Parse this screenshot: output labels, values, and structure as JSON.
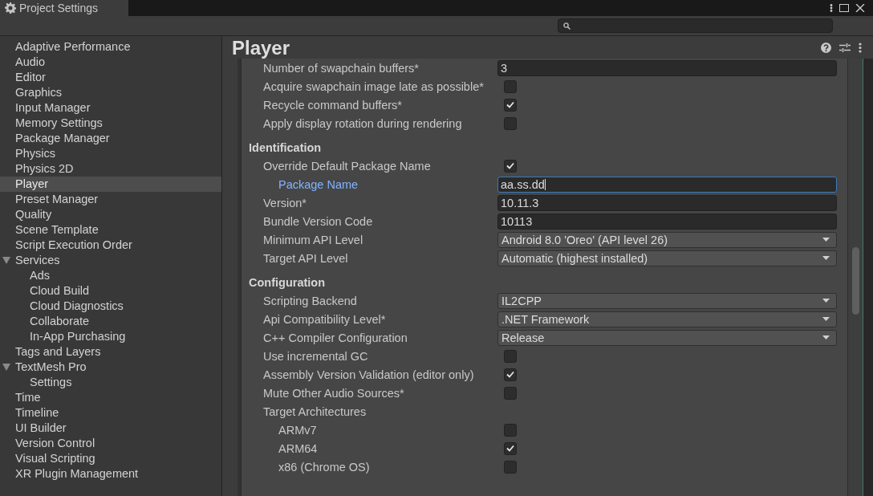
{
  "window": {
    "title": "Project Settings"
  },
  "sidebar": {
    "items": [
      {
        "label": "Adaptive Performance",
        "selected": false
      },
      {
        "label": "Audio",
        "selected": false
      },
      {
        "label": "Editor",
        "selected": false
      },
      {
        "label": "Graphics",
        "selected": false
      },
      {
        "label": "Input Manager",
        "selected": false
      },
      {
        "label": "Memory Settings",
        "selected": false
      },
      {
        "label": "Package Manager",
        "selected": false
      },
      {
        "label": "Physics",
        "selected": false
      },
      {
        "label": "Physics 2D",
        "selected": false
      },
      {
        "label": "Player",
        "selected": true
      },
      {
        "label": "Preset Manager",
        "selected": false
      },
      {
        "label": "Quality",
        "selected": false
      },
      {
        "label": "Scene Template",
        "selected": false
      },
      {
        "label": "Script Execution Order",
        "selected": false
      },
      {
        "label": "Services",
        "selected": false,
        "expanded": true,
        "children": [
          {
            "label": "Ads",
            "selected": false
          },
          {
            "label": "Cloud Build",
            "selected": false
          },
          {
            "label": "Cloud Diagnostics",
            "selected": false
          },
          {
            "label": "Collaborate",
            "selected": false
          },
          {
            "label": "In-App Purchasing",
            "selected": false
          }
        ]
      },
      {
        "label": "Tags and Layers",
        "selected": false
      },
      {
        "label": "TextMesh Pro",
        "selected": false,
        "expanded": true,
        "children": [
          {
            "label": "Settings",
            "selected": false
          }
        ]
      },
      {
        "label": "Time",
        "selected": false
      },
      {
        "label": "Timeline",
        "selected": false
      },
      {
        "label": "UI Builder",
        "selected": false
      },
      {
        "label": "Version Control",
        "selected": false
      },
      {
        "label": "Visual Scripting",
        "selected": false
      },
      {
        "label": "XR Plugin Management",
        "selected": false
      }
    ]
  },
  "inspector": {
    "title": "Player",
    "rows": [
      {
        "kind": "field",
        "label": "Number of swapchain buffers*",
        "value": "3",
        "focused": false
      },
      {
        "kind": "checkbox",
        "label": "Acquire swapchain image late as possible*",
        "checked": false
      },
      {
        "kind": "checkbox",
        "label": "Recycle command buffers*",
        "checked": true
      },
      {
        "kind": "checkbox",
        "label": "Apply display rotation during rendering",
        "checked": false
      },
      {
        "kind": "header",
        "label": "Identification"
      },
      {
        "kind": "checkbox",
        "label": "Override Default Package Name",
        "checked": true,
        "children": [
          {
            "kind": "field",
            "label": "Package Name",
            "value": "aa.ss.dd",
            "focused": true
          }
        ]
      },
      {
        "kind": "field",
        "label": "Version*",
        "value": "10.11.3",
        "focused": false
      },
      {
        "kind": "field",
        "label": "Bundle Version Code",
        "value": "10113",
        "focused": false
      },
      {
        "kind": "dropdown",
        "label": "Minimum API Level",
        "value": "Android 8.0 'Oreo' (API level 26)"
      },
      {
        "kind": "dropdown",
        "label": "Target API Level",
        "value": "Automatic (highest installed)"
      },
      {
        "kind": "header",
        "label": "Configuration"
      },
      {
        "kind": "dropdown",
        "label": "Scripting Backend",
        "value": "IL2CPP"
      },
      {
        "kind": "dropdown",
        "label": "Api Compatibility Level*",
        "value": ".NET Framework"
      },
      {
        "kind": "dropdown",
        "label": "C++ Compiler Configuration",
        "value": "Release"
      },
      {
        "kind": "checkbox",
        "label": "Use incremental GC",
        "checked": false
      },
      {
        "kind": "checkbox",
        "label": "Assembly Version Validation (editor only)",
        "checked": true
      },
      {
        "kind": "checkbox",
        "label": "Mute Other Audio Sources*",
        "checked": false
      },
      {
        "kind": "label",
        "label": "Target Architectures",
        "children": [
          {
            "kind": "checkbox",
            "label": "ARMv7",
            "checked": false
          },
          {
            "kind": "checkbox",
            "label": "ARM64",
            "checked": true
          },
          {
            "kind": "checkbox",
            "label": "x86 (Chrome OS)",
            "checked": false
          }
        ]
      }
    ]
  }
}
